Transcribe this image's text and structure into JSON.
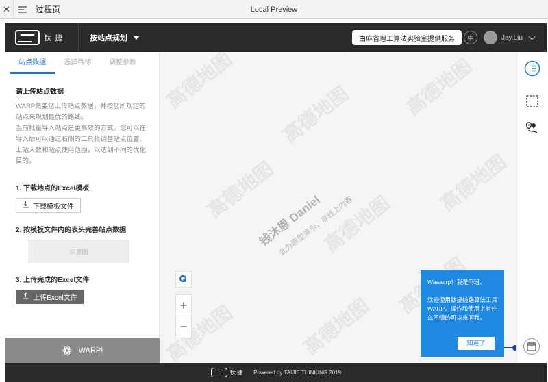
{
  "browser": {
    "tab_title": "过程页",
    "window_title": "Local Preview"
  },
  "nav": {
    "logo_text": "钛 捷",
    "plan_label": "按站点规划",
    "service_button": "由麻省理工算法实验室提供服务",
    "lang": "中",
    "user_name": "Jay.Liu"
  },
  "panel": {
    "tabs": [
      {
        "label": "站点数据",
        "active": true
      },
      {
        "label": "选择目标",
        "active": false
      },
      {
        "label": "调整参数",
        "active": false
      }
    ],
    "heading": "请上传站点数据",
    "desc1": "WARP需要您上传站点数据，并按您所规定的站点来规划最优的路线。",
    "desc2": "当前批量导入站点是更高效的方式。您可以在导入后可以通过右侧的工具栏调整站点位置、上站人数和站点使用范围，以达到不同的优化目的。",
    "step1": "1. 下载地点的Excel模板",
    "step1_button": "下载模板文件",
    "step2": "2. 按模板文件内的表头完善站点数据",
    "sample_label": "示意图",
    "step3": "3. 上传完成的Excel文件",
    "step3_button": "上传Excel文件",
    "warp_button": "WARP!"
  },
  "map": {
    "watermark_text": "高德地图",
    "overlay_name": "钱沐恩 Daniel",
    "overlay_sub": "此为原型演示，非线上内容",
    "zoom_in": "+",
    "zoom_out": "−"
  },
  "bubble": {
    "greeting": "Waaaarp！我是阿班。",
    "body": "欢迎使用钛捷线路算法工具WARP，操作和使用上有什么不懂的可以来问我。",
    "ok_button": "知道了"
  },
  "footer": {
    "logo_text": "钛 捷",
    "powered": "Powered by TAIJIE THINKING 2019"
  },
  "colors": {
    "accent": "#1976d2",
    "bubble": "#1e88e5",
    "topbar": "#2b2b2b"
  }
}
